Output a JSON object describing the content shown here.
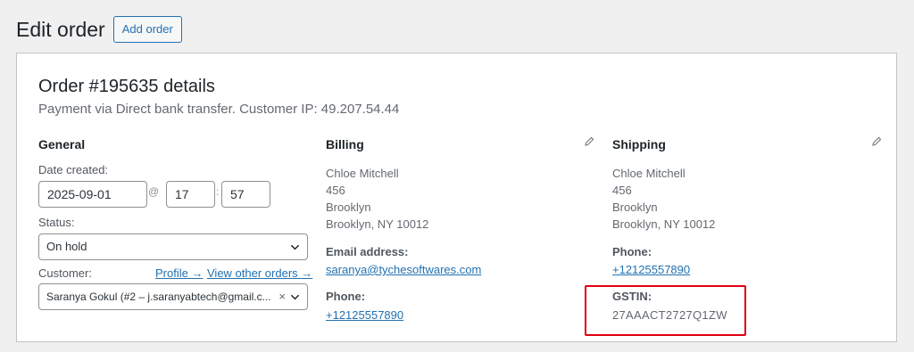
{
  "header": {
    "title": "Edit order",
    "add_order_label": "Add order"
  },
  "order": {
    "title": "Order #195635 details",
    "subtitle": "Payment via Direct bank transfer. Customer IP: 49.207.54.44"
  },
  "general": {
    "heading": "General",
    "date_label": "Date created:",
    "date_value": "2025-09-01",
    "at": "@",
    "hour": "17",
    "colon": ":",
    "minute": "57",
    "status_label": "Status:",
    "status_value": "On hold",
    "customer_label": "Customer:",
    "profile_link": "Profile →",
    "other_orders_link": "View other orders →",
    "customer_value": "Saranya Gokul (#2 – j.saranyabtech@gmail.c...",
    "clear_glyph": "×"
  },
  "billing": {
    "heading": "Billing",
    "address": [
      "Chloe Mitchell",
      "456",
      "Brooklyn",
      "Brooklyn, NY 10012"
    ],
    "email_label": "Email address:",
    "email": "saranya@tychesoftwares.com",
    "phone_label": "Phone:",
    "phone": "+12125557890"
  },
  "shipping": {
    "heading": "Shipping",
    "address": [
      "Chloe Mitchell",
      "456",
      "Brooklyn",
      "Brooklyn, NY 10012"
    ],
    "phone_label": "Phone:",
    "phone": "+12125557890",
    "gstin_label": "GSTIN:",
    "gstin": "27AAACT2727Q1ZW"
  },
  "colors": {
    "link": "#2271b1",
    "highlight": "#e0000f"
  },
  "icons": [
    "pencil-icon",
    "chevron-down-icon",
    "clear-icon"
  ]
}
